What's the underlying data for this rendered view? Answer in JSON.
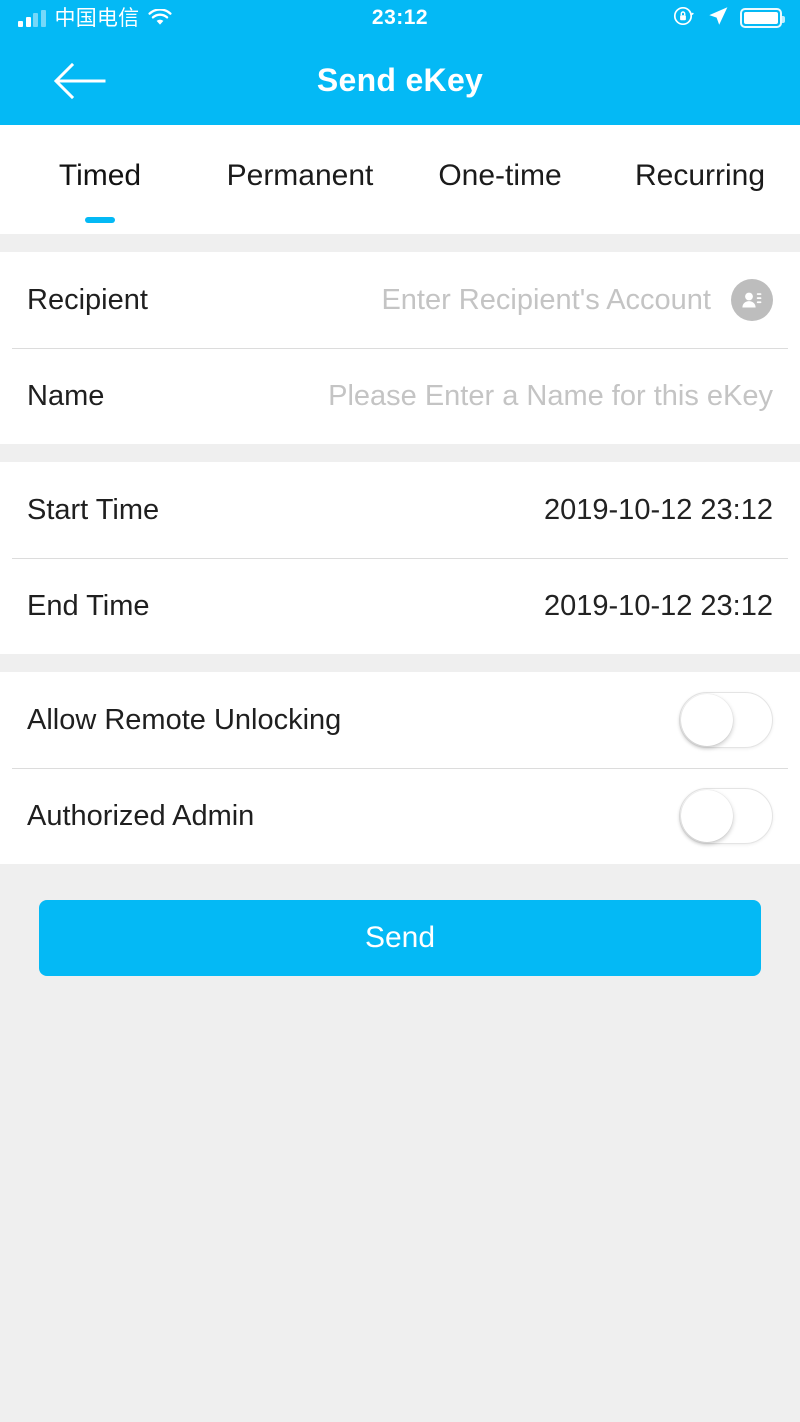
{
  "statusbar": {
    "carrier": "中国电信",
    "time": "23:12",
    "signal_icon": "cellular-signal-icon",
    "wifi_icon": "wifi-icon",
    "rotation_lock_icon": "rotation-lock-icon",
    "location_icon": "location-arrow-icon",
    "battery_icon": "battery-icon"
  },
  "header": {
    "title": "Send eKey",
    "back_icon": "back-arrow-icon"
  },
  "tabs": {
    "items": [
      {
        "label": "Timed",
        "active": true
      },
      {
        "label": "Permanent",
        "active": false
      },
      {
        "label": "One-time",
        "active": false
      },
      {
        "label": "Recurring",
        "active": false
      }
    ]
  },
  "form": {
    "recipient": {
      "label": "Recipient",
      "value": "",
      "placeholder": "Enter Recipient's Account",
      "contact_icon": "contacts-icon"
    },
    "name": {
      "label": "Name",
      "value": "",
      "placeholder": "Please Enter a Name for this eKey"
    },
    "start_time": {
      "label": "Start Time",
      "value": "2019-10-12 23:12"
    },
    "end_time": {
      "label": "End Time",
      "value": "2019-10-12 23:12"
    },
    "allow_remote_unlocking": {
      "label": "Allow Remote Unlocking",
      "state": "off"
    },
    "authorized_admin": {
      "label": "Authorized Admin",
      "state": "off"
    }
  },
  "actions": {
    "send_label": "Send"
  },
  "colors": {
    "accent": "#04b9f5",
    "page_background": "#efefef",
    "card_background": "#ffffff",
    "separator": "#dcdcdc",
    "placeholder_text": "#c4c4c4",
    "primary_text": "#1f1f1f"
  }
}
